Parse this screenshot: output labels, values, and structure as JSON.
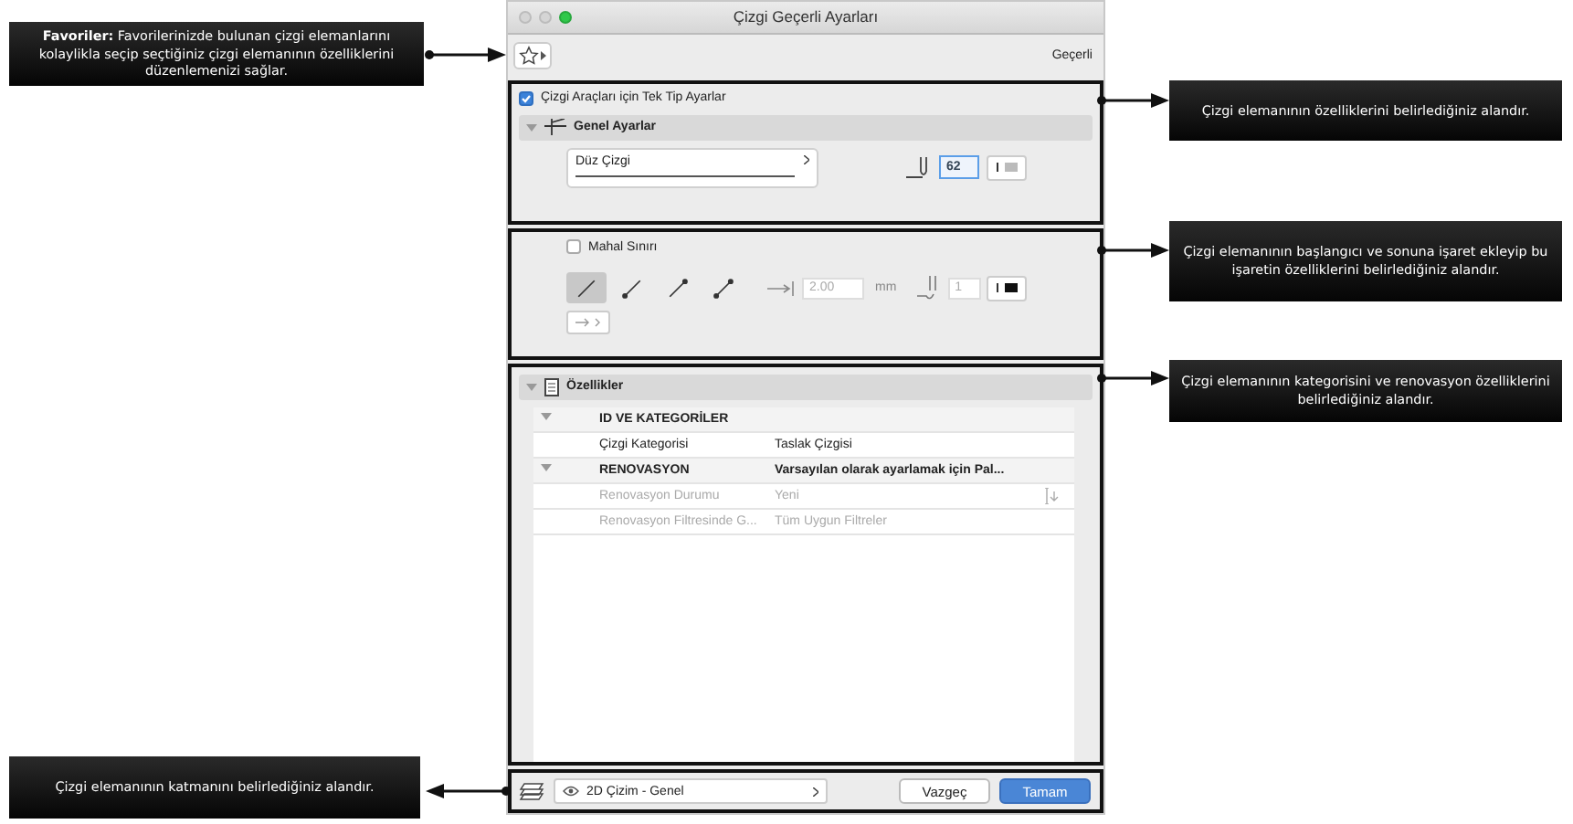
{
  "dialog": {
    "title": "Çizgi Geçerli Ayarları",
    "toolbar": {
      "current_label": "Geçerli"
    },
    "single_type": {
      "label": "Çizgi Araçları için Tek Tip Ayarlar",
      "checked": true
    },
    "general": {
      "title": "Genel Ayarlar",
      "expanded": true,
      "line_type": "Düz Çizgi",
      "pen": "62"
    },
    "markers": {
      "label": "Mahal Sınırı",
      "checked": false,
      "styles": [
        {
          "selected": true
        },
        {
          "selected": false
        },
        {
          "selected": false
        },
        {
          "selected": false
        }
      ],
      "size": "2.00",
      "unit": "mm",
      "pen": "1"
    },
    "properties": {
      "title": "Özellikler",
      "expanded": true,
      "groups": [
        {
          "title": "ID VE KATEGORİLER",
          "expanded": true,
          "rows": [
            {
              "label": "Çizgi Kategorisi",
              "value": "Taslak Çizgisi",
              "disabled": false
            }
          ]
        },
        {
          "title": "RENOVASYON",
          "value": "Varsayılan olarak ayarlamak için Pal...",
          "expanded": true,
          "rows": [
            {
              "label": "Renovasyon Durumu",
              "value": "Yeni",
              "disabled": true
            },
            {
              "label": "Renovasyon Filtresinde G...",
              "value": "Tüm Uygun Filtreler",
              "disabled": true
            }
          ]
        }
      ]
    },
    "footer": {
      "layer": "2D Çizim - Genel",
      "buttons": [
        {
          "label": "Vazgeç",
          "kind": "normal"
        },
        {
          "label": "Tamam",
          "kind": "default"
        }
      ]
    }
  },
  "callouts": [
    {
      "text": "**Favoriler:** Favorilerinizde bulunan çizgi elemanlarını kolaylikla seçip seçtiğiniz çizgi elemanının özelliklerini düzenlemenizi sağlar."
    },
    {
      "text": "Çizgi elemanının özelliklerini belirlediğiniz alandır."
    },
    {
      "text": "Çizgi elemanının başlangıcı ve sonuna işaret ekleyip bu işaretin özelliklerini belirlediğiniz alandır."
    },
    {
      "text": "Çizgi elemanının kategorisini ve renovasyon özelliklerini belirlediğiniz alandır."
    },
    {
      "text": "Çizgi elemanının katmanını belirlediğiniz alandır."
    }
  ]
}
